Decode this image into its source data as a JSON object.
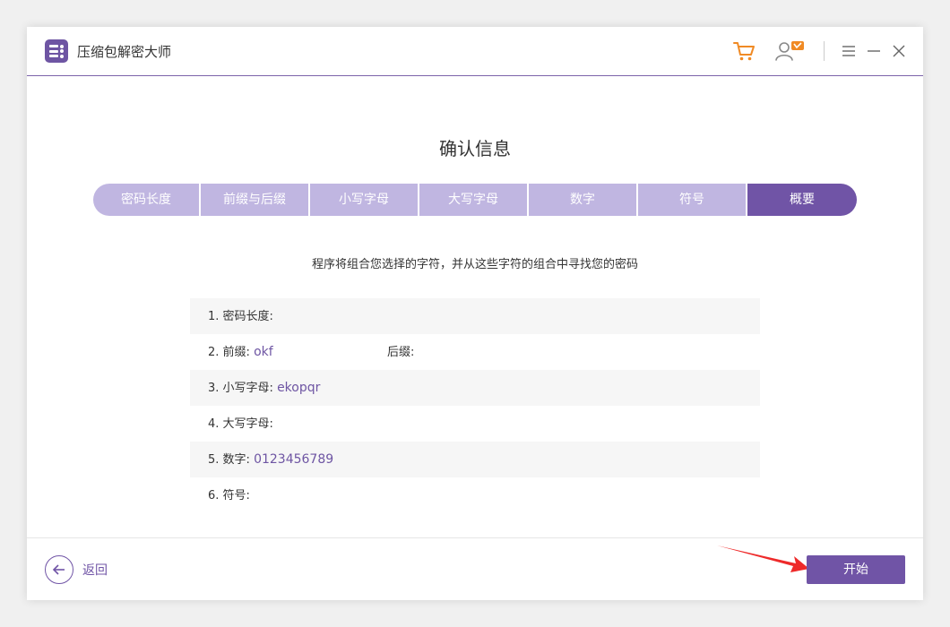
{
  "app": {
    "title": "压缩包解密大师"
  },
  "colors": {
    "accent": "#7054a6",
    "step_inactive": "#c0b6e1",
    "cart": "#f08a24",
    "badge": "#f08a24"
  },
  "icons": {
    "logo": "app-logo-icon",
    "cart": "cart-icon",
    "account": "user-vip-icon",
    "menu": "menu-icon",
    "minimize": "minimize-icon",
    "close": "close-icon",
    "back": "arrow-left-icon"
  },
  "main": {
    "title": "确认信息",
    "description": "程序将组合您选择的字符，并从这些字符的组合中寻找您的密码"
  },
  "steps": [
    {
      "label": "密码长度",
      "active": false
    },
    {
      "label": "前缀与后缀",
      "active": false
    },
    {
      "label": "小写字母",
      "active": false
    },
    {
      "label": "大写字母",
      "active": false
    },
    {
      "label": "数字",
      "active": false
    },
    {
      "label": "符号",
      "active": false
    },
    {
      "label": "概要",
      "active": true
    }
  ],
  "summary": {
    "length_label": "1. 密码长度:",
    "length_value": "",
    "prefix_label": "2. 前缀:",
    "prefix_value": "okf",
    "suffix_label": "后缀:",
    "suffix_value": "",
    "lowercase_label": "3. 小写字母:",
    "lowercase_value": "ekopqr",
    "uppercase_label": "4. 大写字母:",
    "uppercase_value": "",
    "digits_label": "5. 数字:",
    "digits_value": "0123456789",
    "symbols_label": "6. 符号:",
    "symbols_value": ""
  },
  "footer": {
    "back_label": "返回",
    "start_label": "开始"
  }
}
